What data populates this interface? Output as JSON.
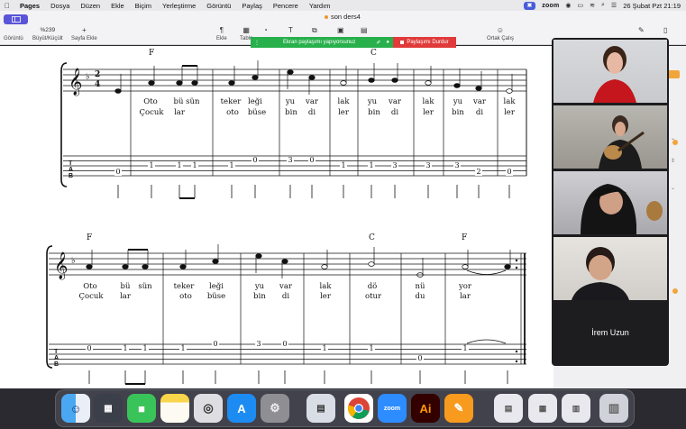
{
  "menubar": {
    "app_name": "Pages",
    "items": [
      "Dosya",
      "Düzen",
      "Ekle",
      "Biçim",
      "Yerleştirme",
      "Görüntü",
      "Paylaş",
      "Pencere",
      "Yardım"
    ],
    "zoom_label": "zoom",
    "datetime": "26 Şubat Pzt  21:19"
  },
  "toolbar": {
    "document_title": "son ders4",
    "view_label": "Görüntü",
    "zoom_value": "%239",
    "zoom_label": "Büyüt/Küçült",
    "add_page_label": "Sayfa Ekle",
    "insert_label": "Ekle",
    "table_label": "Tablo",
    "collaborate_label": "Ortak Çalış"
  },
  "share_banner": {
    "status": "Ekran paylaşımı yapıyorsunuz",
    "stop_label": "Paylaşımı Durdur"
  },
  "score": {
    "system1": {
      "chords": [
        "F",
        "C"
      ],
      "lyrics_top": [
        "Oto",
        "bü sün",
        "teker",
        "leği",
        "yu",
        "var",
        "lak",
        "yu",
        "var",
        "lak",
        "yu",
        "var",
        "lak"
      ],
      "lyrics_bottom": [
        "Çocuk",
        "lar",
        "oto",
        "büse",
        "bin",
        "di",
        "ler",
        "bin",
        "di",
        "ler",
        "bin",
        "di",
        "ler"
      ],
      "tab_numbers": [
        "0",
        "1",
        "1",
        "1",
        "1",
        "0",
        "3",
        "0",
        "1",
        "1",
        "3",
        "3",
        "3",
        "0",
        "2",
        "0",
        "0"
      ]
    },
    "system2": {
      "chords": [
        "F",
        "C",
        "F"
      ],
      "lyrics_top": [
        "Oto",
        "bü",
        "sün",
        "teker",
        "leği",
        "yu",
        "var",
        "lak",
        "dö",
        "nü",
        "yor"
      ],
      "lyrics_bottom": [
        "Çocuk",
        "lar",
        "oto",
        "büse",
        "bin",
        "di",
        "ler",
        "otur",
        "du",
        "lar"
      ],
      "tab_numbers": [
        "0",
        "1",
        "1",
        "1",
        "1",
        "0",
        "3",
        "0",
        "1",
        "1",
        "0",
        "1",
        "0"
      ]
    }
  },
  "zoom": {
    "participant_name": "İrem Uzun"
  },
  "dock": {
    "apps": [
      "finder-icon",
      "launchpad-icon",
      "facetime-icon",
      "notes-icon",
      "screenshot-icon",
      "app-store-icon",
      "system-settings-icon",
      "pages-doc-icon",
      "chrome-icon",
      "zoom-icon",
      "illustrator-icon",
      "pages-icon",
      "trash-icon"
    ],
    "zoom_app_label": "zoom",
    "illustrator_label": "Ai"
  },
  "colors": {
    "accent": "#5a54d8",
    "share_green": "#27b04b",
    "share_red": "#e03a3a"
  }
}
